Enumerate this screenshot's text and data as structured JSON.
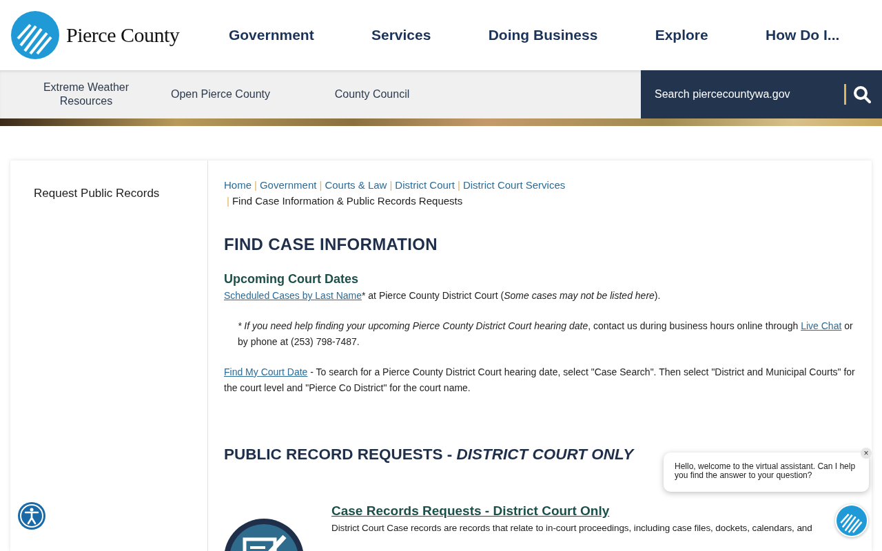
{
  "logo": {
    "text": "Pierce County"
  },
  "main_nav": [
    "Government",
    "Services",
    "Doing Business",
    "Explore",
    "How Do I..."
  ],
  "sub_nav": [
    "Extreme Weather Resources",
    "Open Pierce County",
    "County Council"
  ],
  "search": {
    "placeholder": "Search piercecountywa.gov"
  },
  "sidebar": {
    "items": [
      "Request Public Records"
    ]
  },
  "breadcrumb": {
    "separator": "|",
    "links": [
      "Home",
      "Government",
      "Courts & Law",
      "District Court",
      "District Court Services"
    ],
    "current": "Find Case Information & Public Records Requests"
  },
  "page_title": "FIND CASE INFORMATION",
  "upcoming": {
    "heading": "Upcoming Court Dates",
    "paragraphs": [
      {
        "indent": false,
        "segments": [
          {
            "kind": "link",
            "text": "Scheduled Cases by Last Name"
          },
          {
            "kind": "text",
            "text": "* at Pierce County District Court ("
          },
          {
            "kind": "italic",
            "text": "Some cases may not be listed here"
          },
          {
            "kind": "text",
            "text": ")."
          }
        ]
      },
      {
        "indent": true,
        "segments": [
          {
            "kind": "italic",
            "text": "* If you need help finding your upcoming Pierce County District Court hearing date"
          },
          {
            "kind": "text",
            "text": ", contact us during business hours online through "
          },
          {
            "kind": "link",
            "text": "Live Chat"
          },
          {
            "kind": "text",
            "text": " or by phone at (253) 798-7487."
          }
        ]
      },
      {
        "indent": false,
        "segments": [
          {
            "kind": "link",
            "text": "Find My Court Date"
          },
          {
            "kind": "text",
            "text": " - To search for a Pierce County District Court hearing date, select \"Case Search\".  Then select \"District and Municipal Courts\" for the court level and \"Pierce Co District\" for the court name."
          }
        ]
      }
    ]
  },
  "records_heading": "PUBLIC RECORD REQUESTS - *DISTRICT COURT ONLY*",
  "case_records": {
    "title": "Case Records Requests - District Court Only",
    "text": "District Court Case records are records that relate to in-court proceedings, including case files, dockets, calendars, and"
  },
  "chat": {
    "message": "Hello, welcome to the virtual assistant. Can I help you find the answer to your question?",
    "close": "×"
  }
}
